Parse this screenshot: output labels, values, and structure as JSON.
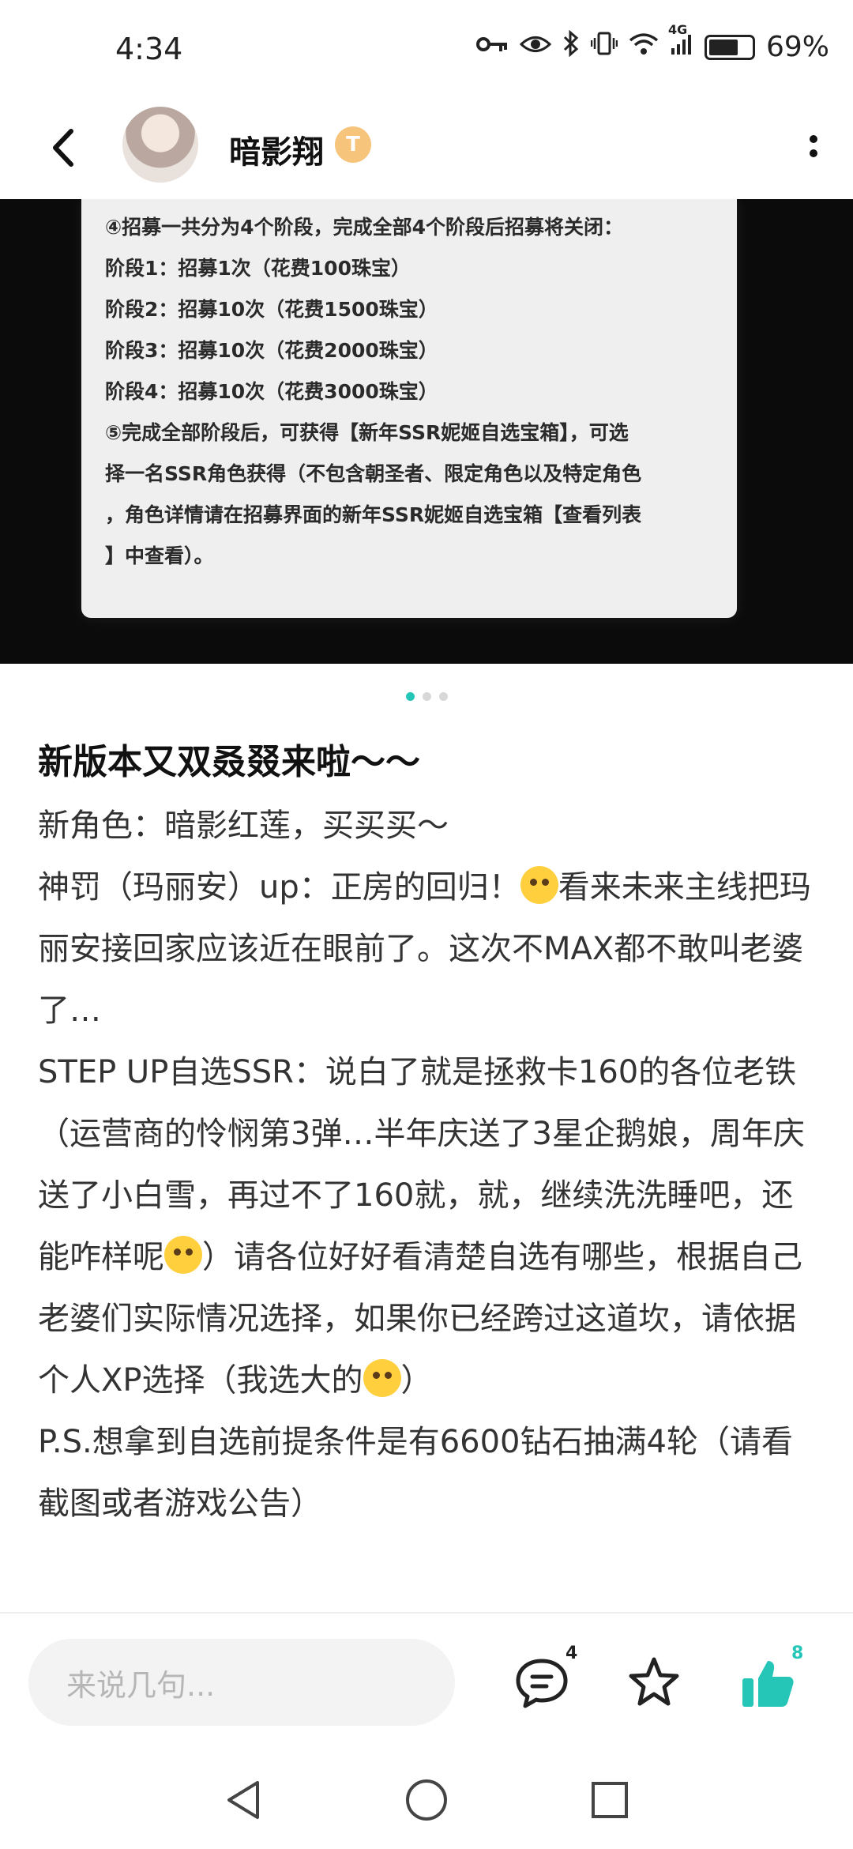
{
  "status_bar": {
    "time": "4:34",
    "network_label": "4G",
    "battery_level": 0.69,
    "battery_text": "69%"
  },
  "header": {
    "username": "暗影翔",
    "badge_text": "T"
  },
  "screenshot_card": {
    "lines": [
      "④招募一共分为4个阶段，完成全部4个阶段后招募将关闭：",
      "阶段1：招募1次（花费100珠宝）",
      "阶段2：招募10次（花费1500珠宝）",
      "阶段3：招募10次（花费2000珠宝）",
      "阶段4：招募10次（花费3000珠宝）",
      "⑤完成全部阶段后，可获得【新年SSR妮姬自选宝箱】，可选",
      "择一名SSR角色获得（不包含朝圣者、限定角色以及特定角色",
      "，角色详情请在招募界面的新年SSR妮姬自选宝箱【查看列表",
      "】中查看）。"
    ]
  },
  "carousel": {
    "count": 3,
    "active": 0
  },
  "post": {
    "title": "新版本又双叒叕来啦～～",
    "p1": "新角色：暗影红莲，买买买～",
    "p2a": "神罚（玛丽安）up：正房的回归！",
    "p2b": "看来未来主线把玛丽安接回家应该近在眼前了。这次不MAX都不敢叫老婆了…",
    "p3a": "STEP UP自选SSR：说白了就是拯救卡160的各位老铁（运营商的怜悯第3弹…半年庆送了3星企鹅娘，周年庆送了小白雪，再过不了160就，就，继续洗洗睡吧，还能咋样呢",
    "p3b": "）请各位好好看清楚自选有哪些，根据自己老婆们实际情况选择，如果你已经跨过这道坎，请依据个人XP选择（我选大的",
    "p3c": "）",
    "p4": "P.S.想拿到自选前提条件是有6600钻石抽满4轮（请看截图或者游戏公告）"
  },
  "bottom_bar": {
    "comment_placeholder": "来说几句...",
    "comment_count": "4",
    "like_count": "8"
  },
  "colors": {
    "accent": "#25c6b8",
    "text": "#333333"
  }
}
